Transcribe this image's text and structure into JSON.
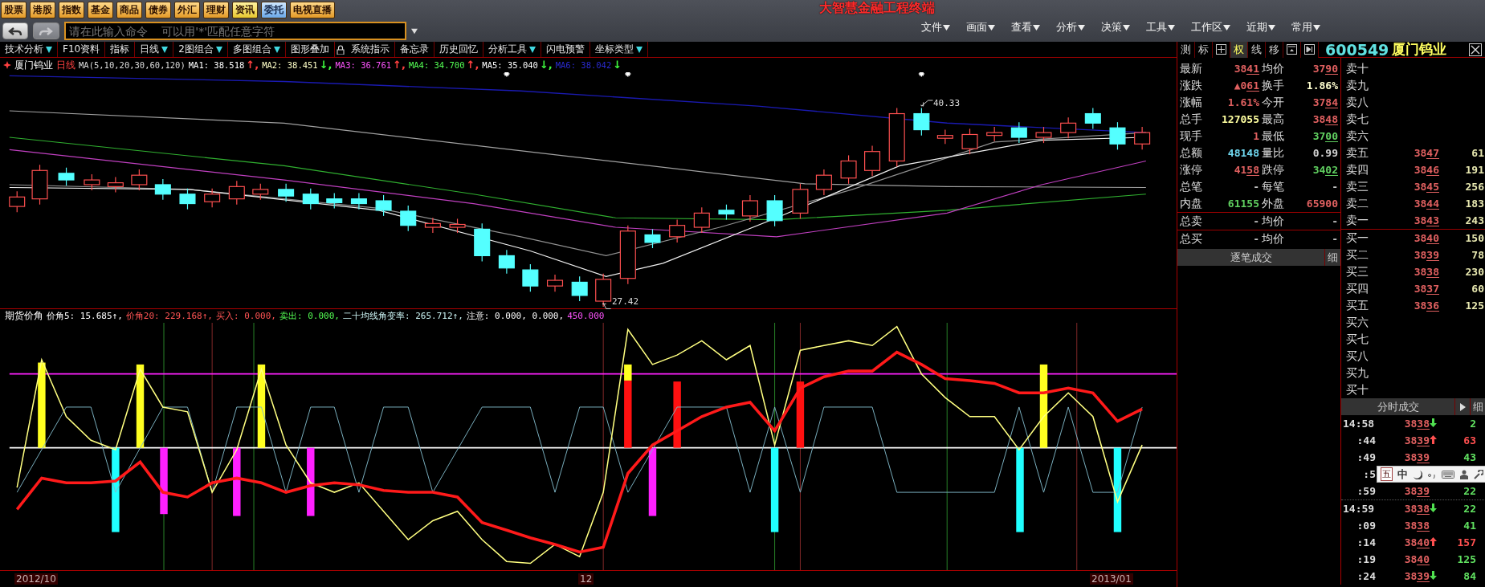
{
  "top_buttons": [
    {
      "label": "股票",
      "kind": "orange"
    },
    {
      "label": "港股",
      "kind": "orange"
    },
    {
      "label": "指数",
      "kind": "orange"
    },
    {
      "label": "基金",
      "kind": "orange"
    },
    {
      "label": "商品",
      "kind": "orange"
    },
    {
      "label": "债券",
      "kind": "orange"
    },
    {
      "label": "外汇",
      "kind": "orange"
    },
    {
      "label": "理财",
      "kind": "orange"
    },
    {
      "label": "资讯",
      "kind": "yellow"
    },
    {
      "label": "委托",
      "kind": "blue"
    },
    {
      "label": "电视直播",
      "kind": "orange"
    }
  ],
  "nav_buttons": [
    {
      "kind": "back",
      "disabled": false
    },
    {
      "kind": "forward",
      "disabled": true
    }
  ],
  "command": {
    "placeholder": "请在此输入命令    可以用'*'匹配任意字符"
  },
  "app_title": "大智慧金融工程终端",
  "menu": [
    "文件",
    "画面",
    "查看",
    "分析",
    "决策",
    "工具",
    "工作区",
    "近期",
    "常用"
  ],
  "toolbar": [
    {
      "kind": "text",
      "label": "技术分析",
      "dropdown": true
    },
    {
      "kind": "text",
      "label": "F10资料",
      "dropdown": false
    },
    {
      "kind": "text",
      "label": "指标",
      "dropdown": false
    },
    {
      "kind": "text",
      "label": "日线",
      "dropdown": true
    },
    {
      "kind": "text",
      "label": "2图组合",
      "dropdown": true
    },
    {
      "kind": "text",
      "label": "多图组合",
      "dropdown": true
    },
    {
      "kind": "text",
      "label": "图形叠加",
      "dropdown": false
    },
    {
      "kind": "lock"
    },
    {
      "kind": "text",
      "label": "系统指示",
      "dropdown": false
    },
    {
      "kind": "text",
      "label": "备忘录",
      "dropdown": false
    },
    {
      "kind": "text",
      "label": "历史回忆",
      "dropdown": false
    },
    {
      "kind": "text",
      "label": "分析工具",
      "dropdown": true
    },
    {
      "kind": "text",
      "label": "闪电预警",
      "dropdown": false
    },
    {
      "kind": "text",
      "label": "坐标类型",
      "dropdown": true
    }
  ],
  "panel_tools": [
    {
      "kind": "text",
      "label": "测",
      "selected": false
    },
    {
      "kind": "text",
      "label": "标",
      "selected": false
    },
    {
      "kind": "grid",
      "selected": false
    },
    {
      "kind": "text",
      "label": "权",
      "selected": true
    },
    {
      "kind": "text",
      "label": "线",
      "selected": false
    },
    {
      "kind": "text",
      "label": "移",
      "selected": false
    },
    {
      "kind": "panel",
      "selected": false
    },
    {
      "kind": "end",
      "selected": false
    }
  ],
  "stock": {
    "code": "600549",
    "name": "厦门钨业"
  },
  "chart": {
    "stock_name": "厦门钨业",
    "period": "日线",
    "ma_params": "MA(5,10,20,30,60,120)",
    "ma": [
      {
        "label": "MA1: 38.518",
        "arrow": {
          "text": "↑,",
          "color": "#ff4040"
        },
        "color": "#ffffff"
      },
      {
        "label": "MA2: 38.451",
        "arrow": {
          "text": "↓,",
          "color": "#40ff40"
        },
        "color": "#ffffc8"
      },
      {
        "label": "MA3: 36.761",
        "arrow": {
          "text": "↑,",
          "color": "#ff4040"
        },
        "color": "#ff54ff"
      },
      {
        "label": "MA4: 34.700",
        "arrow": {
          "text": "↑,",
          "color": "#ff4040"
        },
        "color": "#54ff54"
      },
      {
        "label": "MA5: 35.040",
        "arrow": {
          "text": "↓,",
          "color": "#40ff40"
        },
        "color": "#ffffff"
      },
      {
        "label": "MA6: 38.042",
        "arrow": {
          "text": "↓",
          "color": "#40ff40"
        },
        "color": "#2a2ad0"
      }
    ],
    "high_label": "40.33",
    "low_label": "27.42"
  },
  "indicator": {
    "name": "期货价角",
    "items": [
      {
        "label": "价角5: 15.685",
        "arrow": "↑,",
        "color": "#ffffff"
      },
      {
        "label": "价角20: 229.168",
        "arrow": "↑,",
        "color": "#ff5454"
      },
      {
        "label": "买入: 0.000,",
        "color": "#ff5454"
      },
      {
        "label": "卖出: 0.000,",
        "color": "#54ff54"
      },
      {
        "label": "二十均线角变率: 265.712",
        "arrow": "↑,",
        "color": "#c8f0f0"
      },
      {
        "label": "注意: 0.000, 0.000,",
        "color": "#ffffff"
      },
      {
        "label": "450.000",
        "color": "#ff54ff"
      }
    ]
  },
  "axis_dates": [
    "2012/10",
    "12",
    "2013/01"
  ],
  "quote_rows": [
    {
      "divider_before": false,
      "cells": [
        {
          "label": "最新",
          "value": "3841",
          "kind": "price",
          "color": "#e06060"
        },
        {
          "label": "均价",
          "value": "3790",
          "kind": "price",
          "color": "#e06060"
        }
      ]
    },
    {
      "divider_before": false,
      "cells": [
        {
          "label": "涨跌",
          "value": "▲061",
          "kind": "price",
          "color": "#e06060"
        },
        {
          "label": "换手",
          "value": "1.86%",
          "kind": "plain",
          "color": "#ffffd0"
        }
      ]
    },
    {
      "divider_before": false,
      "cells": [
        {
          "label": "涨幅",
          "value": "1.61%",
          "kind": "plain",
          "color": "#e06060"
        },
        {
          "label": "今开",
          "value": "3784",
          "kind": "price",
          "color": "#e06060"
        }
      ]
    },
    {
      "divider_before": false,
      "cells": [
        {
          "label": "总手",
          "value": "127055",
          "kind": "plain",
          "color": "#ffffa0"
        },
        {
          "label": "最高",
          "value": "3848",
          "kind": "price",
          "color": "#e06060"
        }
      ]
    },
    {
      "divider_before": false,
      "cells": [
        {
          "label": "现手",
          "value": "1",
          "kind": "plain",
          "color": "#e06060"
        },
        {
          "label": "最低",
          "value": "3700",
          "kind": "price",
          "color": "#60d060"
        }
      ]
    },
    {
      "divider_before": false,
      "cells": [
        {
          "label": "总额",
          "value": "48148",
          "kind": "plain",
          "color": "#70d8f0"
        },
        {
          "label": "量比",
          "value": "0.99",
          "kind": "plain",
          "color": "#d0d0d0"
        }
      ]
    },
    {
      "divider_before": false,
      "cells": [
        {
          "label": "涨停",
          "value": "4158",
          "kind": "price",
          "color": "#e06060"
        },
        {
          "label": "跌停",
          "value": "3402",
          "kind": "price",
          "color": "#60d060"
        }
      ]
    },
    {
      "divider_before": false,
      "cells": [
        {
          "label": "总笔",
          "value": "-",
          "kind": "plain",
          "color": "#c0c0c0"
        },
        {
          "label": "每笔",
          "value": "-",
          "kind": "plain",
          "color": "#c0c0c0"
        }
      ]
    },
    {
      "divider_before": false,
      "cells": [
        {
          "label": "内盘",
          "value": "61155",
          "kind": "plain",
          "color": "#60d060"
        },
        {
          "label": "外盘",
          "value": "65900",
          "kind": "plain",
          "color": "#e06060"
        }
      ]
    },
    {
      "divider_before": true,
      "cells": [
        {
          "label": "总卖",
          "value": "-",
          "kind": "plain",
          "color": "#c0c0c0"
        },
        {
          "label": "均价",
          "value": "-",
          "kind": "plain",
          "color": "#c0c0c0"
        }
      ]
    },
    {
      "divider_before": true,
      "cells": [
        {
          "label": "总买",
          "value": "-",
          "kind": "plain",
          "color": "#c0c0c0"
        },
        {
          "label": "均价",
          "value": "-",
          "kind": "plain",
          "color": "#c0c0c0"
        }
      ]
    }
  ],
  "trade_bar": {
    "label": "逐笔成交",
    "detail": "细"
  },
  "asks": [
    {
      "label": "卖十"
    },
    {
      "label": "卖九"
    },
    {
      "label": "卖八"
    },
    {
      "label": "卖七"
    },
    {
      "label": "卖六"
    },
    {
      "label": "卖五",
      "price": "3847",
      "volume": "61"
    },
    {
      "label": "卖四",
      "price": "3846",
      "volume": "191"
    },
    {
      "label": "卖三",
      "price": "3845",
      "volume": "256"
    },
    {
      "label": "卖二",
      "price": "3844",
      "volume": "183"
    },
    {
      "label": "卖一",
      "price": "3843",
      "volume": "243"
    }
  ],
  "bids": [
    {
      "label": "买一",
      "price": "3840",
      "volume": "150"
    },
    {
      "label": "买二",
      "price": "3839",
      "volume": "78"
    },
    {
      "label": "买三",
      "price": "3838",
      "volume": "230"
    },
    {
      "label": "买四",
      "price": "3837",
      "volume": "60"
    },
    {
      "label": "买五",
      "price": "3836",
      "volume": "125"
    },
    {
      "label": "买六"
    },
    {
      "label": "买七"
    },
    {
      "label": "买八"
    },
    {
      "label": "买九"
    },
    {
      "label": "买十"
    }
  ],
  "ticks": {
    "title": "分时成交",
    "detail": "细",
    "rows": [
      {
        "time": "14:58",
        "kind": "minute",
        "price": "3838",
        "arrow_up": false,
        "arrow_down": true,
        "volume": {
          "text": "2",
          "color": "#60e060"
        }
      },
      {
        "time": ":44",
        "kind": "second",
        "price": "3839",
        "arrow_up": true,
        "arrow_down": false,
        "volume": {
          "text": "63",
          "color": "#ff5050"
        }
      },
      {
        "time": ":49",
        "kind": "second",
        "price": "3839",
        "arrow_up": false,
        "arrow_down": false,
        "volume": {
          "text": "43",
          "color": "#60e060"
        }
      },
      {
        "time": ":5",
        "kind": "second"
      },
      {
        "time": ":59",
        "kind": "second",
        "price": "3839",
        "arrow_up": false,
        "arrow_down": false,
        "volume": {
          "text": "22",
          "color": "#60e060"
        }
      },
      {
        "time": "14:59",
        "kind": "minute",
        "price": "3838",
        "arrow_up": false,
        "arrow_down": true,
        "volume": {
          "text": "22",
          "color": "#60e060"
        }
      },
      {
        "time": ":09",
        "kind": "second",
        "price": "3838",
        "arrow_up": false,
        "arrow_down": false,
        "volume": {
          "text": "41",
          "color": "#60e060"
        }
      },
      {
        "time": ":14",
        "kind": "second",
        "price": "3840",
        "arrow_up": true,
        "arrow_down": false,
        "volume": {
          "text": "157",
          "color": "#ff5050"
        }
      },
      {
        "time": ":19",
        "kind": "second",
        "price": "3840",
        "arrow_up": false,
        "arrow_down": false,
        "volume": {
          "text": "125",
          "color": "#60e060"
        }
      },
      {
        "time": ":24",
        "kind": "second",
        "price": "3839",
        "arrow_up": false,
        "arrow_down": true,
        "volume": {
          "text": "84",
          "color": "#60e060"
        }
      }
    ]
  },
  "ime": {
    "mode": "五",
    "lang": "中"
  }
}
